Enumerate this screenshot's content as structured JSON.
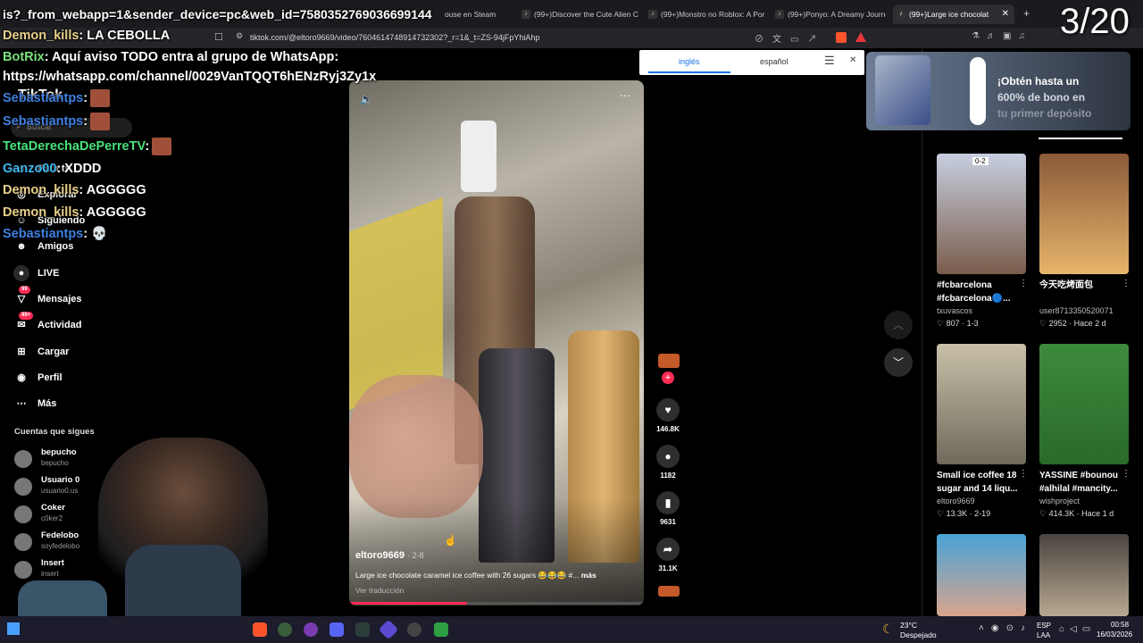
{
  "browser": {
    "tabs": [
      {
        "label": "(99+)Discover the Cute Alien C",
        "active": false
      },
      {
        "label": "(99+)Monstro no Roblox: A Por",
        "active": false
      },
      {
        "label": "(99+)Ponyo: A Dreamy Journe",
        "active": false
      },
      {
        "label": "(99+)Large ice chocolat",
        "active": true
      }
    ],
    "hidden_tab_fragment": "ouse en Steam",
    "url": "tiktok.com/@eltoro9669/video/7604614748914732302?_r=1&_t=ZS-94jFpYhiAhp"
  },
  "overlay": {
    "counter": "3/20",
    "top_line_1": "is?_from_webapp=1&sender_device=pc&web_id=7580352769036699144",
    "chat": [
      {
        "user": "Demon_kills",
        "color": "#e9d08a",
        "text": ": LA CEBOLLA",
        "emote": false
      },
      {
        "user": "BotRix",
        "color": "#7ae27a",
        "text": ": Aquí aviso TODO entra al grupo de WhatsApp:",
        "emote": false
      },
      {
        "user": "",
        "color": "#fff",
        "text": "https://whatsapp.com/channel/0029VanTQQT6hENzRyj3Zy1x",
        "emote": false
      },
      {
        "user": "Sebastiantps",
        "color": "#3e7fe0",
        "text": ":",
        "emote": true
      },
      {
        "user": "Sebastiantps",
        "color": "#3e7fe0",
        "text": ":",
        "emote": true
      },
      {
        "user": "TetaDerechaDePerreTV",
        "color": "#48e27a",
        "text": ":",
        "emote": true
      },
      {
        "user": "Ganzo00",
        "color": "#3fb6ef",
        "text": ": XDDD",
        "emote": false
      },
      {
        "user": "Demon_kills",
        "color": "#e9d08a",
        "text": ": AGGGGG",
        "emote": false
      },
      {
        "user": "Demon_kills",
        "color": "#e9d08a",
        "text": ": AGGGGG",
        "emote": false
      },
      {
        "user": "Sebastiantps",
        "color": "#3e7fe0",
        "text": ": 💀",
        "emote": false
      }
    ]
  },
  "sidebar": {
    "logo": "TikTok",
    "search_placeholder": "Buscar",
    "nav": [
      {
        "label": "Para ti",
        "icon": "home-icon"
      },
      {
        "label": "Explorar",
        "icon": "compass-icon"
      },
      {
        "label": "Siguiendo",
        "icon": "following-icon"
      },
      {
        "label": "Amigos",
        "icon": "friends-icon"
      },
      {
        "label": "LIVE",
        "icon": "live-icon"
      },
      {
        "label": "Mensajes",
        "icon": "messages-icon",
        "badge": "99"
      },
      {
        "label": "Actividad",
        "icon": "activity-icon",
        "badge": "99+"
      },
      {
        "label": "Cargar",
        "icon": "upload-icon"
      },
      {
        "label": "Perfil",
        "icon": "profile-icon"
      },
      {
        "label": "Más",
        "icon": "more-icon"
      }
    ],
    "following_title": "Cuentas que sigues",
    "following": [
      {
        "name": "bepucho",
        "handle": "bepucho"
      },
      {
        "name": "Usuario 0",
        "handle": "usuario0.us"
      },
      {
        "name": "Coker",
        "handle": "c0ker2"
      },
      {
        "name": "Fedelobo",
        "handle": "soyfedelobo"
      },
      {
        "name": "Insert",
        "handle": "insert"
      }
    ]
  },
  "translate": {
    "lang_from": "inglés",
    "lang_to": "español"
  },
  "video": {
    "author": "eltoro9669",
    "date": "· 2-8",
    "caption": "Large ice chocolate caramel ice coffee with 26 sugars 😂😂😂 #...",
    "more": "más",
    "translate_link": "Ver traducción",
    "progress": 0.4
  },
  "actions": {
    "likes": "146.8K",
    "comments": "1182",
    "saves": "9631",
    "shares": "31.1K"
  },
  "ad": {
    "line1": "¡Obtén hasta un",
    "line2": "600% de bono en",
    "line3": "tu primer depósito"
  },
  "related": [
    {
      "title": "#fcbarcelona #fcbarcelona🔵...",
      "user": "txuvascos",
      "stats": "♡ 807 · 1-3",
      "badge": "0-2"
    },
    {
      "title": "今天吃烤面包",
      "user": "user8713350520071",
      "stats": "♡ 2952 · Hace 2 d",
      "badge": ""
    },
    {
      "title": "Small ice coffee 18 sugar and 14 liqu...",
      "user": "eltoro9669",
      "stats": "♡ 13.3K · 2-19",
      "badge": ""
    },
    {
      "title": "YASSINE #bounou #alhilal #mancity...",
      "user": "wishproject",
      "stats": "♡ 414.3K · Hace 1 d",
      "badge": ""
    },
    {
      "title": "",
      "user": "",
      "stats": "",
      "badge": ""
    },
    {
      "title": "",
      "user": "",
      "stats": "",
      "badge": ""
    }
  ],
  "taskbar": {
    "weather_temp": "23°C",
    "weather_text": "Despejado",
    "lang": "ESP",
    "lang2": "LAA",
    "time": "00:58",
    "date": "16/03/2026"
  }
}
